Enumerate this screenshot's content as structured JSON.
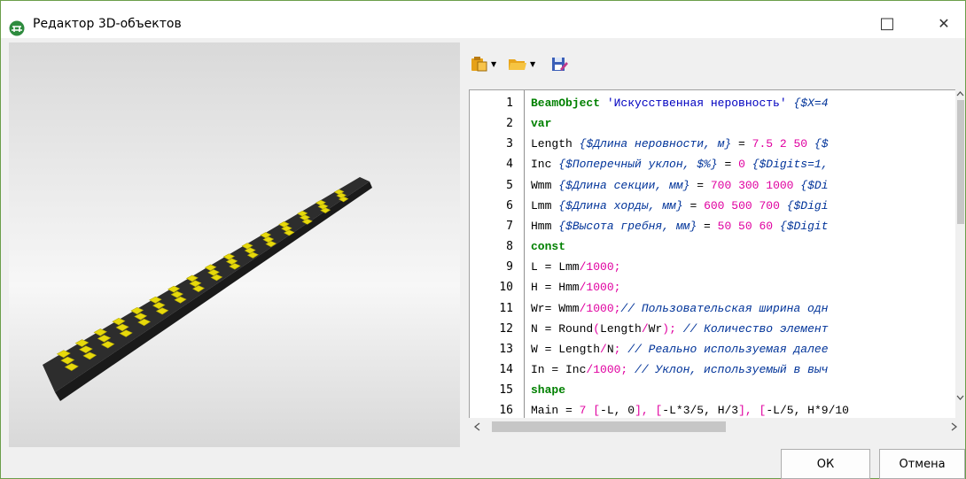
{
  "window": {
    "title": "Редактор 3D-объектов",
    "controls": {
      "maximize": "□",
      "close": "✕"
    }
  },
  "toolbar": {
    "items": [
      {
        "icon": "paste-icon",
        "has_dropdown": true
      },
      {
        "icon": "open-folder-icon",
        "has_dropdown": true
      },
      {
        "icon": "save-edit-icon",
        "has_dropdown": false
      }
    ]
  },
  "editor": {
    "line_numbers": [
      "1",
      "2",
      "3",
      "4",
      "5",
      "6",
      "7",
      "8",
      "9",
      "10",
      "11",
      "12",
      "13",
      "14",
      "15",
      "16"
    ],
    "lines": [
      [
        {
          "t": "kw",
          "v": "BeamObject"
        },
        {
          "t": "txt",
          "v": " "
        },
        {
          "t": "str",
          "v": "'Искусственная неровность'"
        },
        {
          "t": "txt",
          "v": " "
        },
        {
          "t": "cm",
          "v": "{$X=4"
        }
      ],
      [
        {
          "t": "kw",
          "v": "var"
        }
      ],
      [
        {
          "t": "txt",
          "v": "Length "
        },
        {
          "t": "cm",
          "v": "{$Длина неровности, м}"
        },
        {
          "t": "txt",
          "v": " = "
        },
        {
          "t": "num",
          "v": "7.5 2 50"
        },
        {
          "t": "txt",
          "v": " "
        },
        {
          "t": "cm",
          "v": "{$"
        }
      ],
      [
        {
          "t": "txt",
          "v": "Inc "
        },
        {
          "t": "cm",
          "v": "{$Поперечный уклон, $%}"
        },
        {
          "t": "txt",
          "v": " = "
        },
        {
          "t": "num",
          "v": "0"
        },
        {
          "t": "txt",
          "v": " "
        },
        {
          "t": "cm",
          "v": "{$Digits=1,"
        }
      ],
      [
        {
          "t": "txt",
          "v": "Wmm "
        },
        {
          "t": "cm",
          "v": "{$Длина секции, мм}"
        },
        {
          "t": "txt",
          "v": " = "
        },
        {
          "t": "num",
          "v": "700 300 1000"
        },
        {
          "t": "txt",
          "v": " "
        },
        {
          "t": "cm",
          "v": "{$Di"
        }
      ],
      [
        {
          "t": "txt",
          "v": "Lmm "
        },
        {
          "t": "cm",
          "v": "{$Длина хорды, мм}"
        },
        {
          "t": "txt",
          "v": " = "
        },
        {
          "t": "num",
          "v": "600 500 700"
        },
        {
          "t": "txt",
          "v": " "
        },
        {
          "t": "cm",
          "v": "{$Digi"
        }
      ],
      [
        {
          "t": "txt",
          "v": "Hmm "
        },
        {
          "t": "cm",
          "v": "{$Высота гребня, мм}"
        },
        {
          "t": "txt",
          "v": " = "
        },
        {
          "t": "num",
          "v": "50 50 60"
        },
        {
          "t": "txt",
          "v": " "
        },
        {
          "t": "cm",
          "v": "{$Digit"
        }
      ],
      [
        {
          "t": "kw",
          "v": "const"
        }
      ],
      [
        {
          "t": "txt",
          "v": "L = Lmm"
        },
        {
          "t": "op",
          "v": "/1000;"
        }
      ],
      [
        {
          "t": "txt",
          "v": "H = Hmm"
        },
        {
          "t": "op",
          "v": "/1000;"
        }
      ],
      [
        {
          "t": "txt",
          "v": "Wr= Wmm"
        },
        {
          "t": "op",
          "v": "/1000;"
        },
        {
          "t": "cm",
          "v": "// Пользовательская ширина одн"
        }
      ],
      [
        {
          "t": "txt",
          "v": "N = Round"
        },
        {
          "t": "op",
          "v": "("
        },
        {
          "t": "txt",
          "v": "Length"
        },
        {
          "t": "op",
          "v": "/"
        },
        {
          "t": "txt",
          "v": "Wr"
        },
        {
          "t": "op",
          "v": ");"
        },
        {
          "t": "txt",
          "v": " "
        },
        {
          "t": "cm",
          "v": "// Количество элемент"
        }
      ],
      [
        {
          "t": "txt",
          "v": "W = Length"
        },
        {
          "t": "op",
          "v": "/"
        },
        {
          "t": "txt",
          "v": "N"
        },
        {
          "t": "op",
          "v": ";"
        },
        {
          "t": "txt",
          "v": " "
        },
        {
          "t": "cm",
          "v": "// Реально используемая далее"
        }
      ],
      [
        {
          "t": "txt",
          "v": "In = Inc"
        },
        {
          "t": "op",
          "v": "/1000;"
        },
        {
          "t": "txt",
          "v": " "
        },
        {
          "t": "cm",
          "v": "// Уклон, используемый в выч"
        }
      ],
      [
        {
          "t": "kw",
          "v": "shape"
        }
      ],
      [
        {
          "t": "txt",
          "v": "Main = "
        },
        {
          "t": "num",
          "v": "7"
        },
        {
          "t": "txt",
          "v": " "
        },
        {
          "t": "op",
          "v": "["
        },
        {
          "t": "txt",
          "v": "-L, 0"
        },
        {
          "t": "op",
          "v": "],"
        },
        {
          "t": "txt",
          "v": " "
        },
        {
          "t": "op",
          "v": "["
        },
        {
          "t": "txt",
          "v": "-L*3/5, H/3"
        },
        {
          "t": "op",
          "v": "],"
        },
        {
          "t": "txt",
          "v": " "
        },
        {
          "t": "op",
          "v": "["
        },
        {
          "t": "txt",
          "v": "-L/5, H*9/10"
        }
      ]
    ]
  },
  "buttons": {
    "ok": "ОК",
    "cancel": "Отмена"
  },
  "colors": {
    "accent_border": "#6b9e4a",
    "keyword": "#008000",
    "string": "#0000c0",
    "comment": "#003399",
    "number": "#e000a0"
  }
}
